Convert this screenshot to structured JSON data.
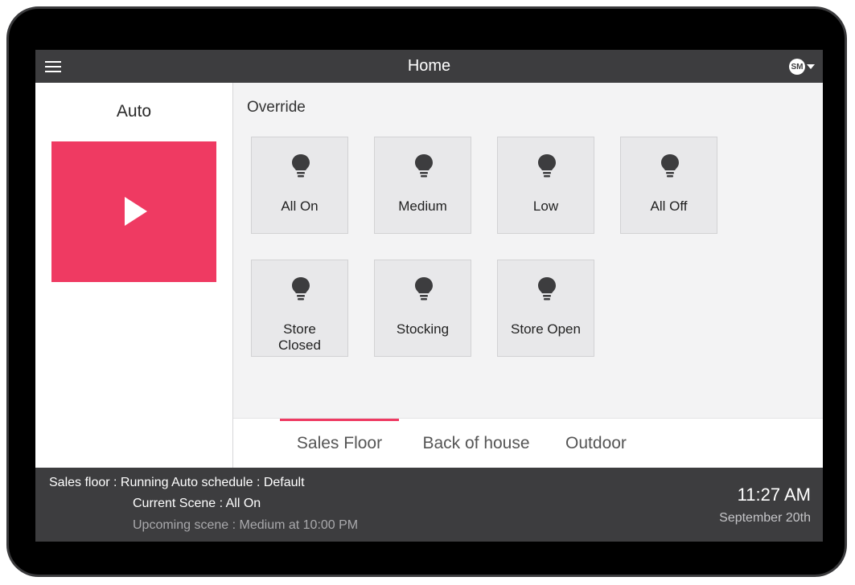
{
  "header": {
    "title": "Home",
    "user_initials": "SM"
  },
  "left_panel": {
    "mode_label": "Auto"
  },
  "override": {
    "label": "Override",
    "scenes": [
      {
        "label": "All On",
        "icon": "lightbulb-icon"
      },
      {
        "label": "Medium",
        "icon": "lightbulb-icon"
      },
      {
        "label": "Low",
        "icon": "lightbulb-icon"
      },
      {
        "label": "All Off",
        "icon": "lightbulb-icon"
      },
      {
        "label": "Store Closed",
        "icon": "lightbulb-icon"
      },
      {
        "label": "Stocking",
        "icon": "lightbulb-icon"
      },
      {
        "label": "Store Open",
        "icon": "lightbulb-icon"
      }
    ]
  },
  "tabs": [
    {
      "label": "Sales Floor",
      "active": true
    },
    {
      "label": "Back of house",
      "active": false
    },
    {
      "label": "Outdoor",
      "active": false
    }
  ],
  "status": {
    "line1": "Sales floor : Running Auto schedule : Default",
    "line2": "Current Scene : All On",
    "line3": "Upcoming scene : Medium at 10:00 PM",
    "time": "11:27 AM",
    "date": "September 20th"
  },
  "colors": {
    "accent": "#ef3a62",
    "bar": "#3d3d3f",
    "tile": "#e8e8ea"
  }
}
